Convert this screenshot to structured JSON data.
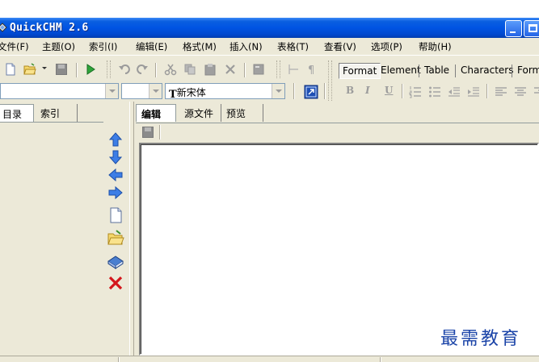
{
  "window": {
    "title": "QuickCHM 2.6"
  },
  "menubar": {
    "items": [
      "文件(F)",
      "主题(O)",
      "索引(I)",
      "编辑(E)",
      "格式(M)",
      "插入(N)",
      "表格(T)",
      "查看(V)",
      "选项(P)",
      "帮助(H)"
    ]
  },
  "format_tabs": [
    "Format",
    "Element",
    "Table",
    "Characters",
    "Form"
  ],
  "font_combo": {
    "value": "新宋体",
    "prefix_glyph": "T"
  },
  "format_buttons": {
    "bold": "B",
    "italic": "I",
    "underline": "U"
  },
  "left_tabs": [
    "目录",
    "索引"
  ],
  "editor_tabs": [
    "编辑",
    "源文件",
    "预览"
  ],
  "watermark": "最需教育",
  "colors": {
    "titlebar": "#0054e3",
    "chrome": "#ece9d8",
    "watermark": "#1b44a8"
  }
}
